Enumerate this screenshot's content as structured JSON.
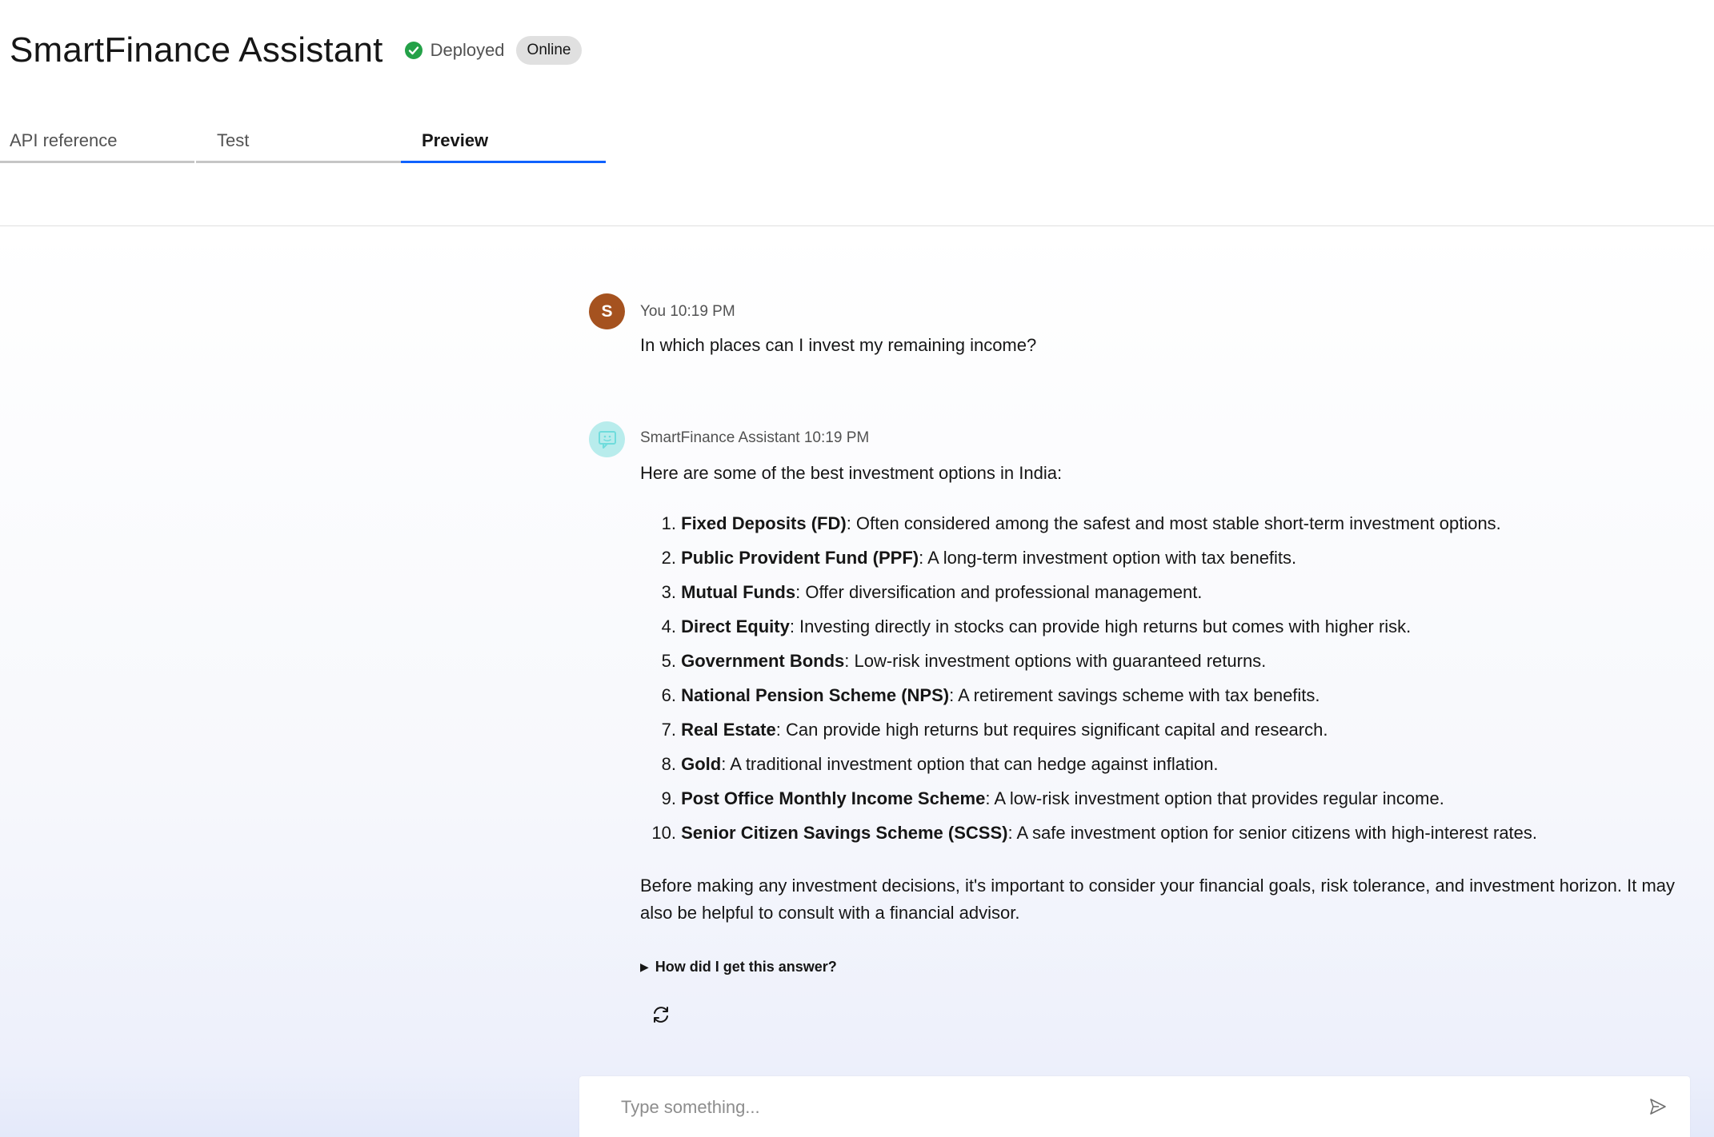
{
  "header": {
    "title": "SmartFinance Assistant",
    "status_label": "Deployed",
    "badge_label": "Online",
    "status_color": "#24a148"
  },
  "tabs": [
    {
      "label": "API reference",
      "active": false
    },
    {
      "label": "Test",
      "active": false
    },
    {
      "label": "Preview",
      "active": true
    }
  ],
  "chat": {
    "user_message": {
      "avatar_initial": "S",
      "meta": "You 10:19 PM",
      "text": "In which places can I invest my remaining income?"
    },
    "bot_message": {
      "meta": "SmartFinance Assistant 10:19 PM",
      "intro": "Here are some of the best investment options in India:",
      "options": [
        {
          "num": "1.",
          "name": "Fixed Deposits (FD)",
          "desc": ": Often considered among the safest and most stable short-term investment options."
        },
        {
          "num": "2.",
          "name": "Public Provident Fund (PPF)",
          "desc": ": A long-term investment option with tax benefits."
        },
        {
          "num": "3.",
          "name": "Mutual Funds",
          "desc": ": Offer diversification and professional management."
        },
        {
          "num": "4.",
          "name": "Direct Equity",
          "desc": ": Investing directly in stocks can provide high returns but comes with higher risk."
        },
        {
          "num": "5.",
          "name": "Government Bonds",
          "desc": ": Low-risk investment options with guaranteed returns."
        },
        {
          "num": "6.",
          "name": "National Pension Scheme (NPS)",
          "desc": ": A retirement savings scheme with tax benefits."
        },
        {
          "num": "7.",
          "name": "Real Estate",
          "desc": ": Can provide high returns but requires significant capital and research."
        },
        {
          "num": "8.",
          "name": "Gold",
          "desc": ": A traditional investment option that can hedge against inflation."
        },
        {
          "num": "9.",
          "name": "Post Office Monthly Income Scheme",
          "desc": ": A low-risk investment option that provides regular income."
        },
        {
          "num": "10.",
          "name": "Senior Citizen Savings Scheme (SCSS)",
          "desc": ": A safe investment option for senior citizens with high-interest rates."
        }
      ],
      "closing": "Before making any investment decisions, it's important to consider your financial goals, risk tolerance, and investment horizon. It may also be helpful to consult with a financial advisor.",
      "details_label": "How did I get this answer?"
    }
  },
  "input": {
    "placeholder": "Type something..."
  },
  "icons": {
    "status": "check-circle-icon",
    "bot_avatar": "chat-bot-icon",
    "regenerate": "refresh-icon",
    "send": "send-icon"
  }
}
